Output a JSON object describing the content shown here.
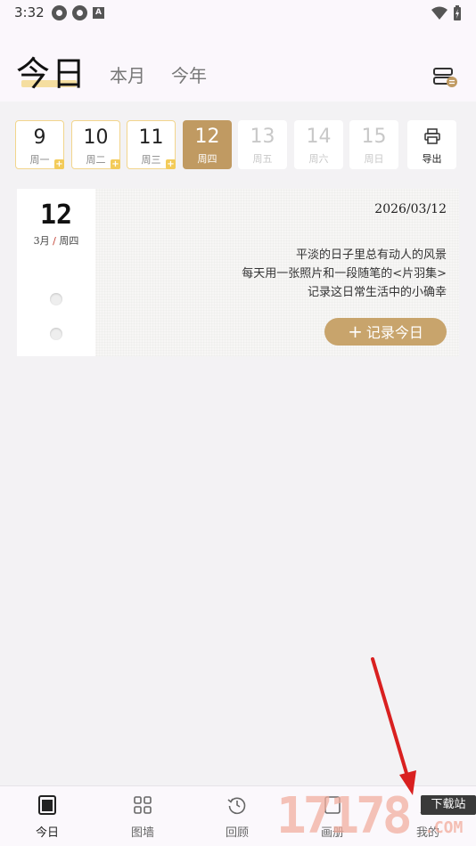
{
  "status_bar": {
    "time": "3:32",
    "icons": [
      "app-icon",
      "app-icon",
      "a-icon",
      "wifi-icon",
      "battery-icon"
    ]
  },
  "header": {
    "tabs": [
      {
        "label": "今日",
        "active": true
      },
      {
        "label": "本月",
        "active": false
      },
      {
        "label": "今年",
        "active": false
      }
    ],
    "menu_icon": "layers-swap-icon"
  },
  "week": {
    "days": [
      {
        "num": "9",
        "weekday": "周一",
        "state": "past"
      },
      {
        "num": "10",
        "weekday": "周二",
        "state": "past"
      },
      {
        "num": "11",
        "weekday": "周三",
        "state": "past"
      },
      {
        "num": "12",
        "weekday": "周四",
        "state": "selected"
      },
      {
        "num": "13",
        "weekday": "周五",
        "state": "future"
      },
      {
        "num": "14",
        "weekday": "周六",
        "state": "future"
      },
      {
        "num": "15",
        "weekday": "周日",
        "state": "future"
      }
    ],
    "badge": "+",
    "export_label": "导出"
  },
  "card": {
    "day": "12",
    "month": "3月",
    "weekday": "周四",
    "date": "2026/03/12",
    "lines": [
      "平淡的日子里总有动人的风景",
      "每天用一张照片和一段随笔的<片羽集>",
      "记录这日常生活中的小确幸"
    ],
    "button_plus": "+",
    "button_label": "记录今日"
  },
  "bottom_nav": {
    "items": [
      {
        "label": "今日",
        "icon": "today-icon",
        "active": true
      },
      {
        "label": "图墙",
        "icon": "grid-icon",
        "active": false
      },
      {
        "label": "回顾",
        "icon": "history-icon",
        "active": false
      },
      {
        "label": "画册",
        "icon": "album-icon",
        "active": false
      },
      {
        "label": "我的",
        "icon": "profile-icon",
        "active": false
      }
    ]
  },
  "watermark": {
    "number": "17178",
    "badge": "下载站",
    "suffix": ".COM"
  },
  "colors": {
    "accent": "#c09a62",
    "button": "#c8a46c",
    "highlight": "#f5dea0",
    "arrow": "#d92020"
  }
}
